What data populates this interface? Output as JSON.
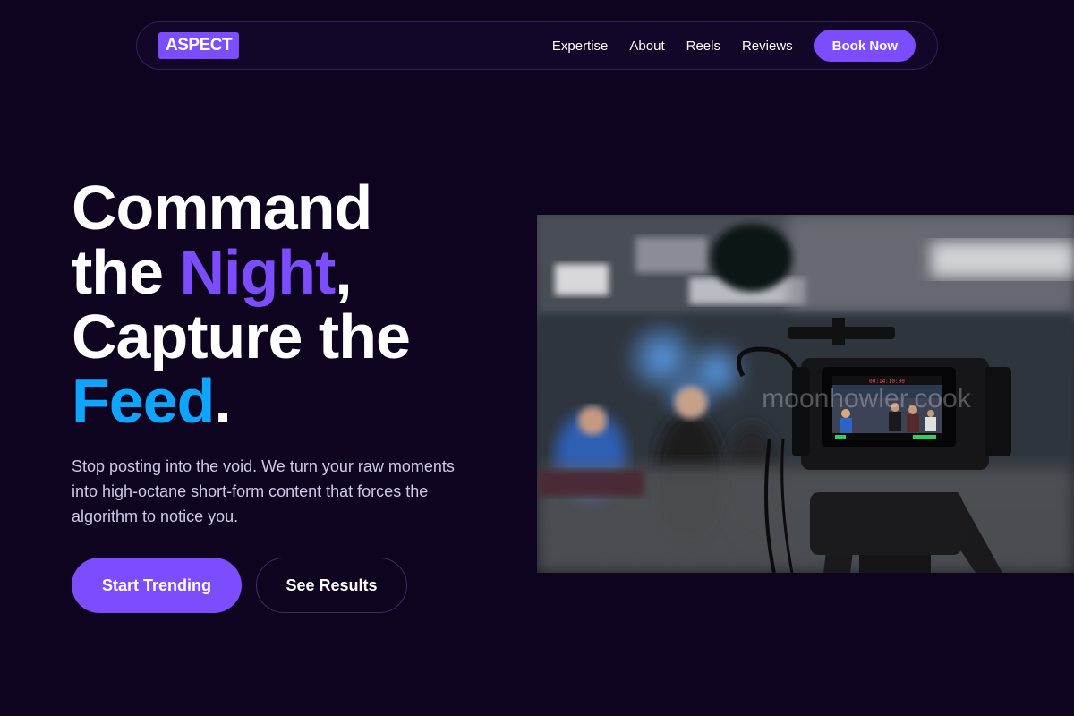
{
  "nav": {
    "logo": "ASPECT",
    "links": [
      "Expertise",
      "About",
      "Reels",
      "Reviews"
    ],
    "cta": "Book Now"
  },
  "hero": {
    "headline": {
      "line1": "Command",
      "line2_a": "the ",
      "line2_accent": "Night",
      "line2_b": ",",
      "line3": "Capture the",
      "line4_accent": "Feed",
      "line4_b": "."
    },
    "subcopy": "Stop posting into the void. We turn your raw moments into high-octane short-form content that forces the algorithm to notice you.",
    "primary_button": "Start Trending",
    "secondary_button": "See Results",
    "image": {
      "watermark": "moonhowler.cook",
      "camera_timecode": "00:14:10:00"
    }
  },
  "colors": {
    "background": "#0e0420",
    "accent_purple": "#7c4dff",
    "accent_blue": "#0ea5ff",
    "muted_text": "#cfc8e6"
  }
}
